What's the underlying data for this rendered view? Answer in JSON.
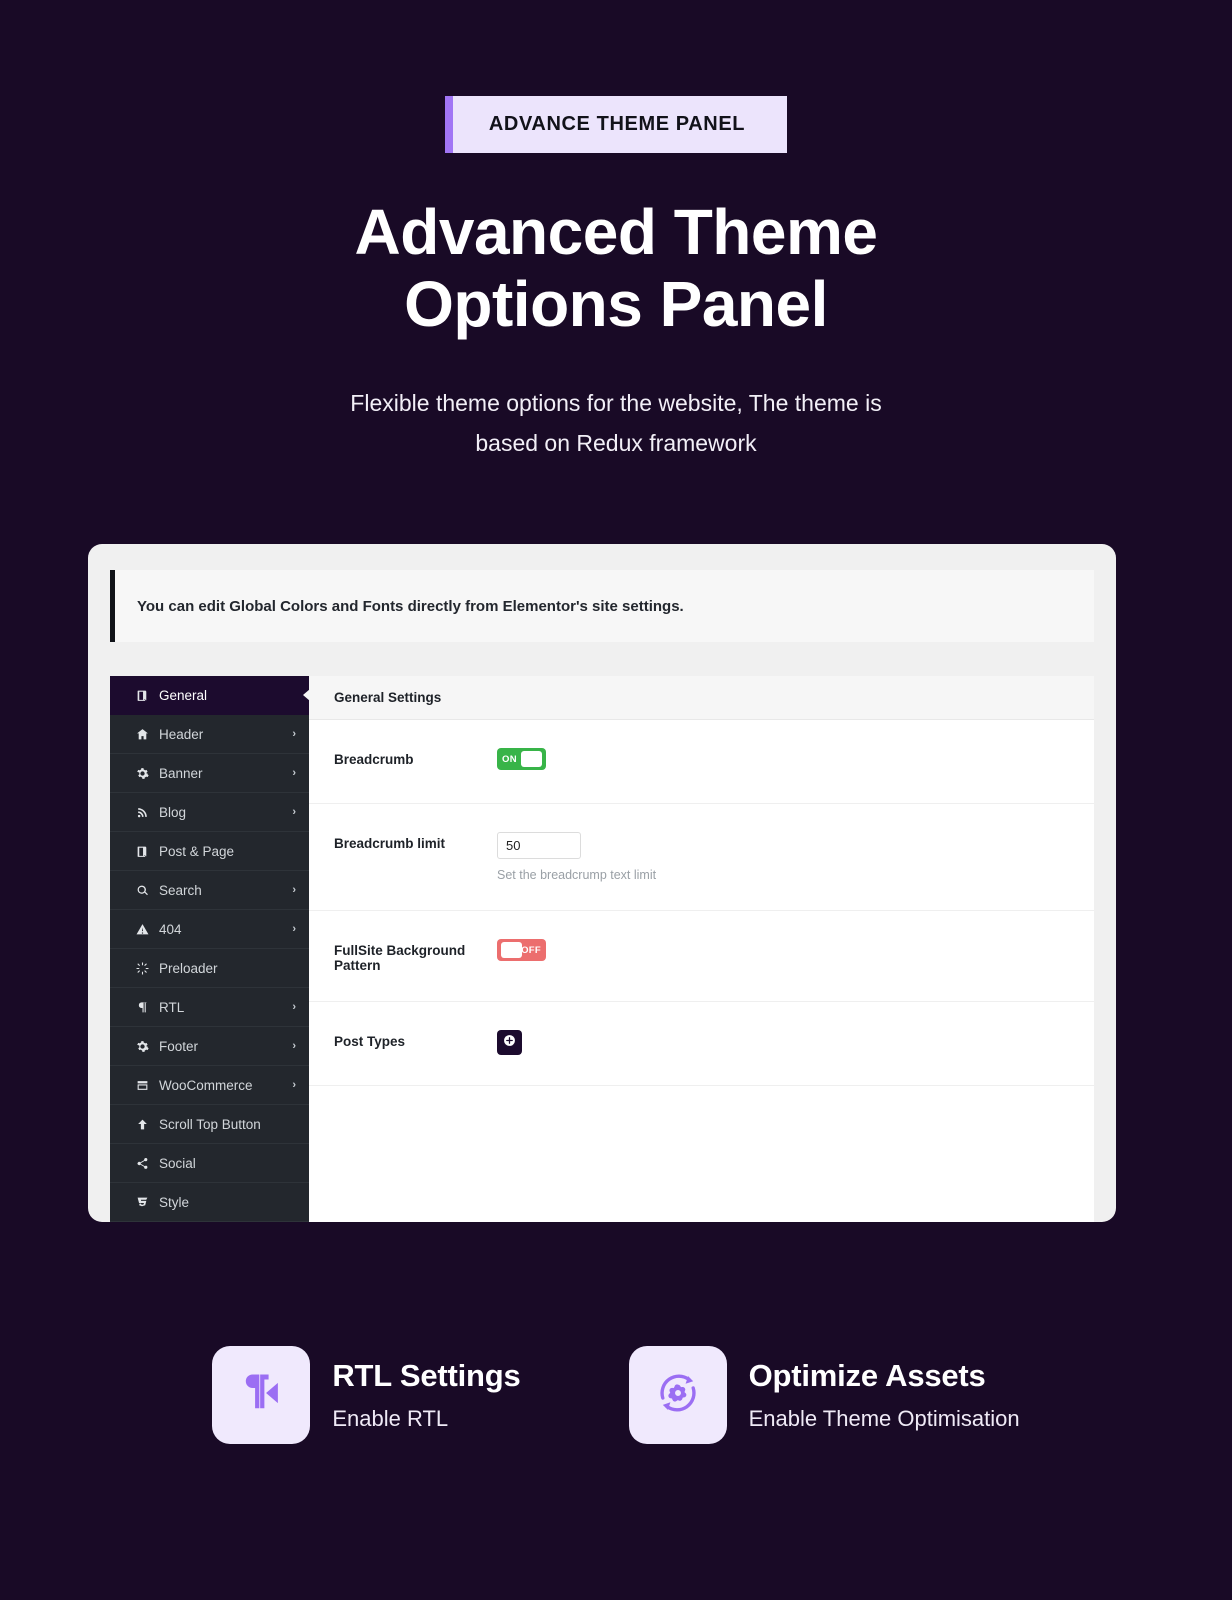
{
  "hero": {
    "badge": "ADVANCE THEME PANEL",
    "title_line1": "Advanced Theme",
    "title_line2": "Options Panel",
    "subtitle": "Flexible theme options for the website, The theme is based on Redux framework",
    "accent_color": "#a175f5",
    "badge_bg": "#ece4fc",
    "background": "#190a26"
  },
  "panel": {
    "notice": "You can edit Global Colors and Fonts directly from Elementor's site settings.",
    "sidebar": {
      "items": [
        {
          "label": "General",
          "icon": "book-icon",
          "has_chevron": false,
          "active": true
        },
        {
          "label": "Header",
          "icon": "home-icon",
          "has_chevron": true,
          "active": false
        },
        {
          "label": "Banner",
          "icon": "gear-icon",
          "has_chevron": true,
          "active": false
        },
        {
          "label": "Blog",
          "icon": "rss-icon",
          "has_chevron": true,
          "active": false
        },
        {
          "label": "Post & Page",
          "icon": "book-icon",
          "has_chevron": false,
          "active": false
        },
        {
          "label": "Search",
          "icon": "search-icon",
          "has_chevron": true,
          "active": false
        },
        {
          "label": "404",
          "icon": "warning-icon",
          "has_chevron": true,
          "active": false
        },
        {
          "label": "Preloader",
          "icon": "spinner-icon",
          "has_chevron": false,
          "active": false
        },
        {
          "label": "RTL",
          "icon": "pilcrow-icon",
          "has_chevron": true,
          "active": false
        },
        {
          "label": "Footer",
          "icon": "gear-icon",
          "has_chevron": true,
          "active": false
        },
        {
          "label": "WooCommerce",
          "icon": "storefront-icon",
          "has_chevron": true,
          "active": false
        },
        {
          "label": "Scroll Top Button",
          "icon": "arrow-up-icon",
          "has_chevron": false,
          "active": false
        },
        {
          "label": "Social",
          "icon": "share-icon",
          "has_chevron": false,
          "active": false
        },
        {
          "label": "Style",
          "icon": "css3-icon",
          "has_chevron": false,
          "active": false
        }
      ],
      "chevron_glyph": "›"
    },
    "content": {
      "header_title": "General Settings",
      "fields": [
        {
          "label": "Breadcrumb",
          "type": "toggle",
          "state": "on",
          "state_label": "ON",
          "color": "#38b448"
        },
        {
          "label": "Breadcrumb limit",
          "type": "text",
          "value": "50",
          "hint": "Set the breadcrump text limit"
        },
        {
          "label": "FullSite Background Pattern",
          "type": "toggle",
          "state": "off",
          "state_label": "OFF",
          "color": "#ec6e6e"
        },
        {
          "label": "Post Types",
          "type": "button",
          "icon": "plus-circle-icon"
        }
      ]
    }
  },
  "features": [
    {
      "title": "RTL Settings",
      "subtitle": "Enable RTL",
      "icon": "rtl-paragraph-icon",
      "icon_color": "#9b6ef3",
      "tile_bg": "#f0e9fd"
    },
    {
      "title": "Optimize Assets",
      "subtitle": "Enable Theme Optimisation",
      "icon": "gear-refresh-icon",
      "icon_color": "#9b6ef3",
      "tile_bg": "#f0e9fd"
    }
  ]
}
